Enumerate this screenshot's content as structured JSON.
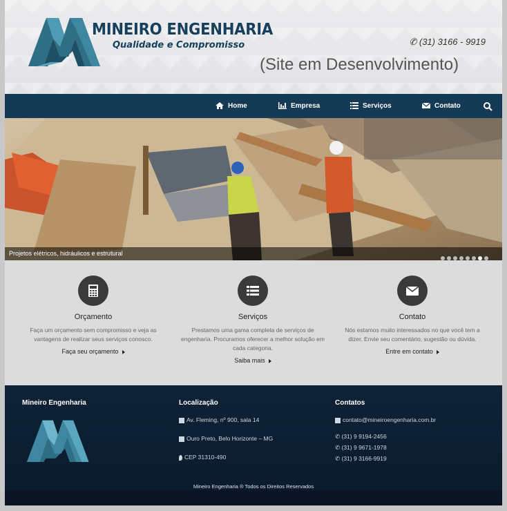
{
  "header": {
    "brand_name": "MINEIRO ENGENHARIA",
    "tagline": "Qualidade e Compromisso",
    "phone": "(31) 3166 - 9919",
    "dev_notice": "(Site em Desenvolvimento)"
  },
  "nav": {
    "items": [
      {
        "label": "Home",
        "icon": "home-icon"
      },
      {
        "label": "Empresa",
        "icon": "chart-icon"
      },
      {
        "label": "Serviços",
        "icon": "list-icon"
      },
      {
        "label": "Contato",
        "icon": "envelope-icon"
      }
    ],
    "search_icon": "search-icon"
  },
  "hero": {
    "caption": "Projetos elétricos, hidráulicos e estrutural",
    "slide_count": 8,
    "active_slide": 7
  },
  "features": [
    {
      "title": "Orçamento",
      "icon": "calculator-icon",
      "text": "Faça um orçamento sem compromisso e veja as vantagens de realizar seus serviços conosco.",
      "link": "Faça seu orçamento"
    },
    {
      "title": "Serviços",
      "icon": "list-icon",
      "text": "Prestamos uma gama completa de serviços de engenharia. Procuramos oferecer a melhor solução em cada categoria.",
      "link": "Saiba mais"
    },
    {
      "title": "Contato",
      "icon": "envelope-icon",
      "text": "Nós estamos muito interessados no que você tem a dizer. Envie seu comentário, sugestão ou dúvida.",
      "link": "Entre em contato"
    }
  ],
  "footer": {
    "company_title": "Mineiro Engenharia",
    "location_title": "Localização",
    "address_line1": "Av. Fleming, nº 900, sala 14",
    "address_line2": "Ouro Preto, Belo Horizonte – MG",
    "cep": "CEP 31310-490",
    "contacts_title": "Contatos",
    "email": "contato@mineiroengenharia.com.br",
    "phones": [
      "(31) 9 9194-2456",
      "(31) 9 9671-1978",
      "(31) 9 3166-9919"
    ],
    "copyright": "Mineiro Engenharia ® Todos os Direitos Reservados"
  },
  "colors": {
    "brand": "#16405c",
    "nav_bg": "#143a55",
    "footer_bg": "#0f2236",
    "icon_circle": "#3a3a3a"
  }
}
